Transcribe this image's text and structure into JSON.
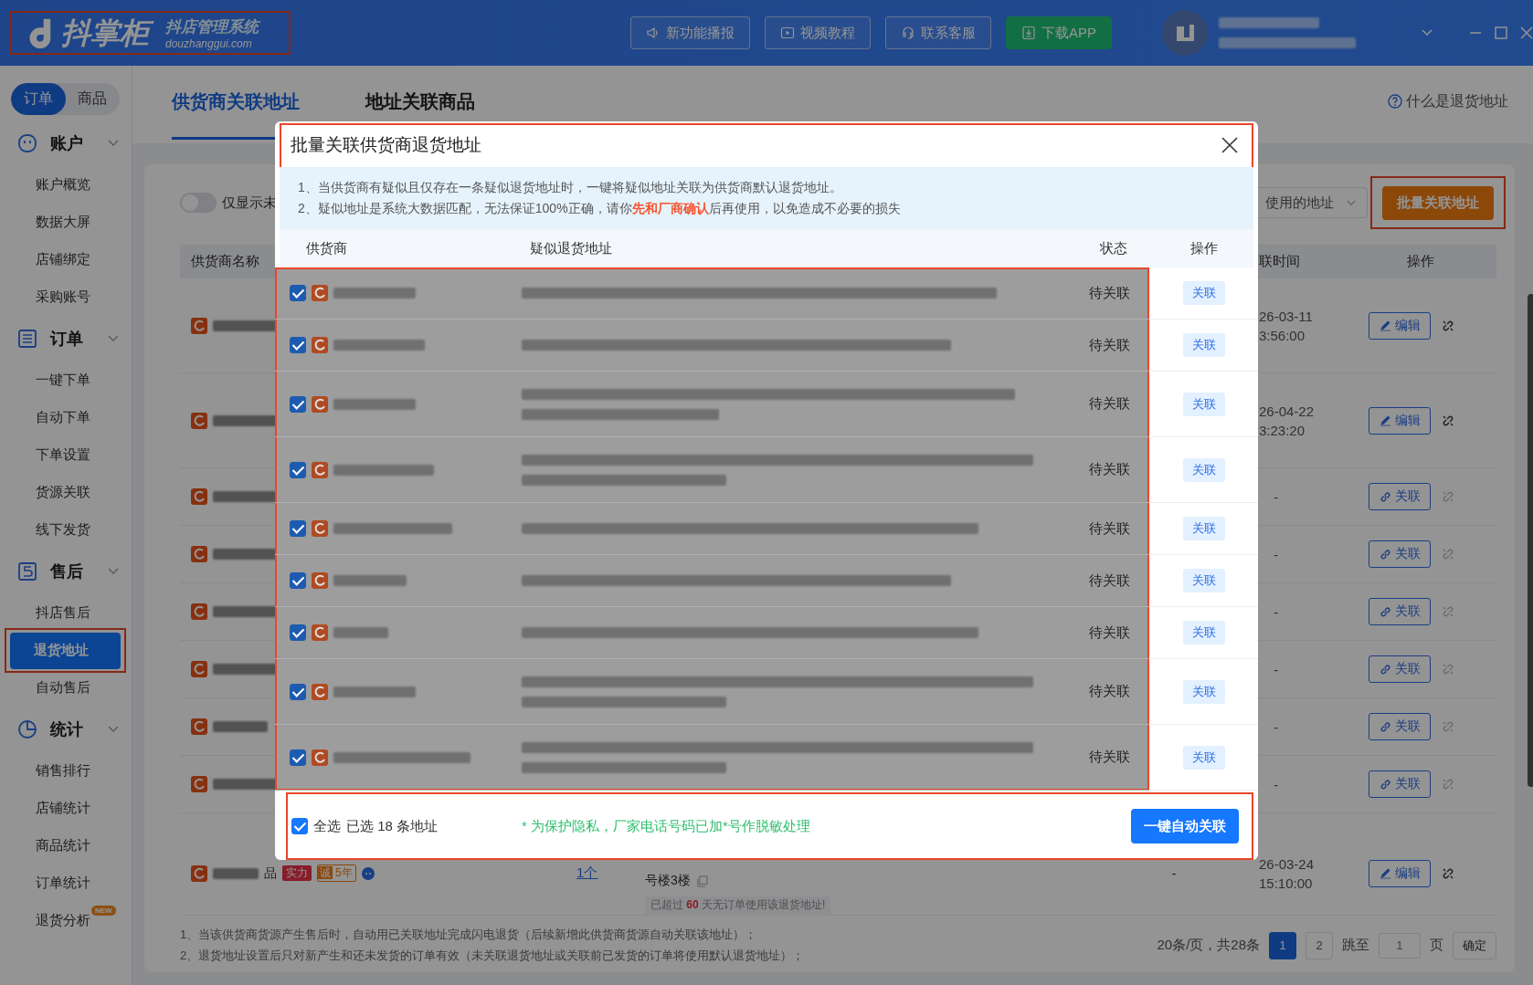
{
  "header": {
    "logo": {
      "name": "抖掌柜",
      "tagline": "抖店管理系统",
      "domain": "douzhanggui.com",
      "annotated": true
    },
    "buttons": [
      {
        "label": "新功能播报",
        "kind": "notice"
      },
      {
        "label": "视频教程",
        "kind": "video"
      },
      {
        "label": "联系客服",
        "kind": "service"
      },
      {
        "label": "下载APP",
        "kind": "download"
      }
    ]
  },
  "sidebar": {
    "switch": [
      {
        "label": "订单",
        "selected": true
      },
      {
        "label": "商品",
        "selected": false
      }
    ],
    "groups": [
      {
        "title": "账户",
        "kind": "account",
        "expanded": true,
        "items": [
          {
            "label": "账户概览",
            "selected": false
          },
          {
            "label": "数据大屏",
            "selected": false
          },
          {
            "label": "店铺绑定",
            "selected": false
          },
          {
            "label": "采购账号",
            "selected": false
          }
        ]
      },
      {
        "title": "订单",
        "kind": "order",
        "expanded": true,
        "items": [
          {
            "label": "一键下单",
            "selected": false
          },
          {
            "label": "自动下单",
            "selected": false
          },
          {
            "label": "下单设置",
            "selected": false
          },
          {
            "label": "货源关联",
            "selected": false
          },
          {
            "label": "线下发货",
            "selected": false
          }
        ]
      },
      {
        "title": "售后",
        "kind": "aftersale",
        "expanded": true,
        "items": [
          {
            "label": "抖店售后",
            "selected": false
          },
          {
            "label": "退货地址",
            "selected": true,
            "annotated": true
          },
          {
            "label": "自动售后",
            "selected": false
          }
        ]
      },
      {
        "title": "统计",
        "kind": "stats",
        "expanded": true,
        "items": [
          {
            "label": "销售排行",
            "selected": false
          },
          {
            "label": "店铺统计",
            "selected": false
          },
          {
            "label": "商品统计",
            "selected": false
          },
          {
            "label": "订单统计",
            "selected": false
          },
          {
            "label": "退货分析",
            "selected": false,
            "badge": "NEW"
          }
        ]
      }
    ]
  },
  "tabs": [
    {
      "label": "供货商关联地址",
      "selected": true
    },
    {
      "label": "地址关联商品",
      "selected": false
    }
  ],
  "help_link": "什么是退货地址",
  "toolbar": {
    "toggle": {
      "label": "仅显示未",
      "on": false
    },
    "filter": {
      "value": "使用的地址"
    },
    "batch_button": {
      "label": "批量关联地址",
      "annotated": true
    }
  },
  "table": {
    "name_header": "供货商名称",
    "time_header": "联时间",
    "action_header": "操作",
    "rows": [
      {
        "time": [
          "26-03-11",
          "3:56:00"
        ],
        "action": {
          "kind": "edit",
          "label": "编辑"
        }
      },
      {
        "time": [
          "26-04-22",
          "3:23:20"
        ],
        "action": {
          "kind": "edit",
          "label": "编辑"
        }
      },
      {
        "time": [
          "-"
        ],
        "action": {
          "kind": "link",
          "label": "关联"
        }
      },
      {
        "time": [
          "-"
        ],
        "action": {
          "kind": "link",
          "label": "关联"
        }
      },
      {
        "time": [
          "-"
        ],
        "action": {
          "kind": "link",
          "label": "关联"
        }
      },
      {
        "time": [
          "-"
        ],
        "action": {
          "kind": "link",
          "label": "关联"
        }
      },
      {
        "time": [
          "-"
        ],
        "action": {
          "kind": "link",
          "label": "关联"
        }
      },
      {
        "time": [
          "-"
        ],
        "action": {
          "kind": "link",
          "label": "关联"
        }
      },
      {
        "name_suffix": "品",
        "badges": [
          {
            "kind": "strength",
            "label": "实力"
          },
          {
            "kind": "years",
            "mark": "诚",
            "label": "5年"
          }
        ],
        "count": "1个",
        "address": "号楼3楼",
        "warning": "已超过 **60** 天无订单使用该退货地址!",
        "status": "-",
        "time": [
          "26-03-24",
          "15:10:00"
        ],
        "action": {
          "kind": "edit",
          "label": "编辑"
        }
      }
    ]
  },
  "notes": [
    "1、当该供货商货源产生售后时，自动用已关联地址完成闪电退货（后续新增此供货商货源自动关联该地址）；",
    "2、退货地址设置后只对新产生和还未发货的订单有效（未关联退货地址或关联前已发货的订单将使用默认退货地址）；"
  ],
  "pagination": {
    "summary": "20条/页，共28条",
    "pages": [
      {
        "label": "1",
        "selected": true
      },
      {
        "label": "2",
        "selected": false
      }
    ],
    "jump_label": "跳至",
    "jump_placeholder": "1",
    "page_unit": "页",
    "confirm": "确定"
  },
  "dialog": {
    "title": "批量关联供货商退货地址",
    "annotated": true,
    "notes": [
      "1、当供货商有疑似且仅存在一条疑似退货地址时，一键将疑似地址关联为供货商默认退货地址。",
      "2、疑似地址是系统大数据匹配，无法保证100%正确，请你**先和厂商确认**后再使用，以免造成不必要的损失"
    ],
    "columns": [
      "供货商",
      "疑似退货地址",
      "状态",
      "操作"
    ],
    "rows": [
      {
        "checked": true,
        "kind": "one_line",
        "status": "待关联",
        "action": "关联"
      },
      {
        "checked": true,
        "kind": "one_line",
        "status": "待关联",
        "action": "关联"
      },
      {
        "checked": true,
        "kind": "two_line",
        "status": "待关联",
        "action": "关联"
      },
      {
        "checked": true,
        "kind": "two_line",
        "status": "待关联",
        "action": "关联"
      },
      {
        "checked": true,
        "kind": "one_line",
        "status": "待关联",
        "action": "关联"
      },
      {
        "checked": true,
        "kind": "one_line",
        "status": "待关联",
        "action": "关联"
      },
      {
        "checked": true,
        "kind": "one_line",
        "status": "待关联",
        "action": "关联"
      },
      {
        "checked": true,
        "kind": "two_line",
        "status": "待关联",
        "action": "关联"
      },
      {
        "checked": true,
        "kind": "two_line",
        "status": "待关联",
        "action": "关联"
      }
    ],
    "select_all": {
      "label": "全选",
      "checked": true,
      "summary": "已选 18 条地址"
    },
    "privacy_note": "* 为保护隐私，厂家电话号码已加*号作脱敏处理",
    "auto_button": "一键自动关联"
  }
}
